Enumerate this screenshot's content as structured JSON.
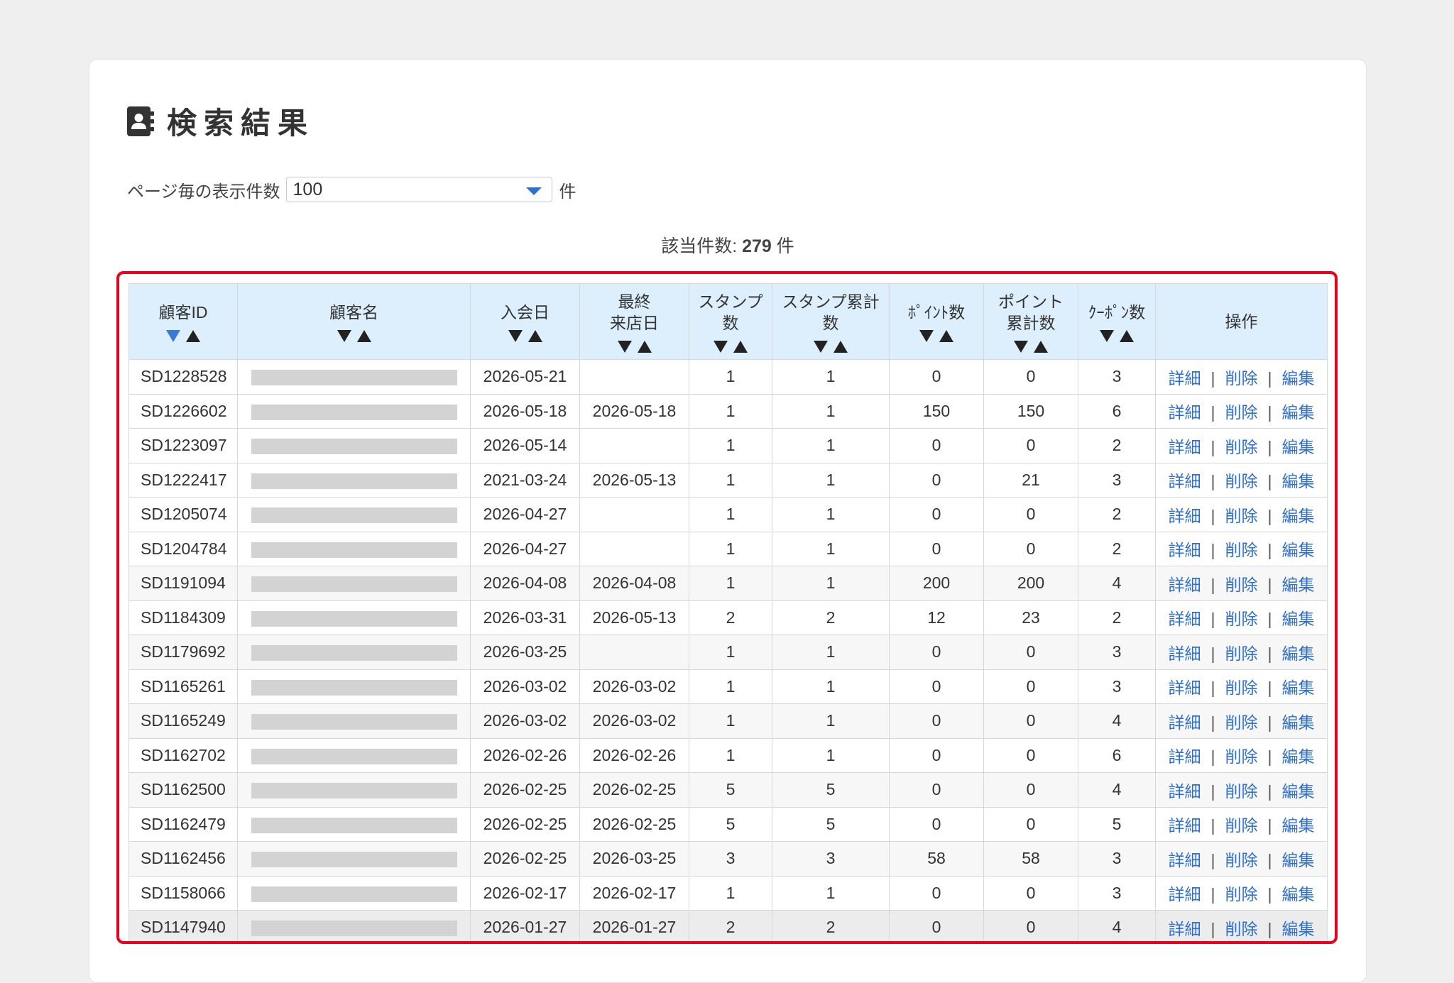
{
  "page": {
    "title": "検索結果",
    "icon": "contact-card-icon"
  },
  "per_page": {
    "label": "ページ毎の表示件数",
    "value": "100",
    "unit": "件"
  },
  "count": {
    "label": "該当件数:",
    "value": "279",
    "unit": "件"
  },
  "table": {
    "columns": [
      {
        "label": "顧客ID",
        "sort_active": "desc"
      },
      {
        "label": "顧客名"
      },
      {
        "label": "入会日"
      },
      {
        "label": "最終\n来店日"
      },
      {
        "label": "スタンプ\n数"
      },
      {
        "label": "スタンプ累計\n数"
      },
      {
        "label": "ﾎﾟｲﾝﾄ数"
      },
      {
        "label": "ポイント\n累計数"
      },
      {
        "label": "ｸｰﾎﾟﾝ数"
      },
      {
        "label": "操作"
      }
    ],
    "ops_labels": {
      "detail": "詳細",
      "delete": "削除",
      "edit": "編集",
      "separator": "|"
    },
    "rows": [
      {
        "id": "SD1228528",
        "join": "2026-05-21",
        "last": "",
        "stamp": "1",
        "stamp_total": "1",
        "points": "0",
        "points_total": "0",
        "coupons": "3"
      },
      {
        "id": "SD1226602",
        "join": "2026-05-18",
        "last": "2026-05-18",
        "stamp": "1",
        "stamp_total": "1",
        "points": "150",
        "points_total": "150",
        "coupons": "6"
      },
      {
        "id": "SD1223097",
        "join": "2026-05-14",
        "last": "",
        "stamp": "1",
        "stamp_total": "1",
        "points": "0",
        "points_total": "0",
        "coupons": "2"
      },
      {
        "id": "SD1222417",
        "join": "2021-03-24",
        "last": "2026-05-13",
        "stamp": "1",
        "stamp_total": "1",
        "points": "0",
        "points_total": "21",
        "coupons": "3"
      },
      {
        "id": "SD1205074",
        "join": "2026-04-27",
        "last": "",
        "stamp": "1",
        "stamp_total": "1",
        "points": "0",
        "points_total": "0",
        "coupons": "2"
      },
      {
        "id": "SD1204784",
        "join": "2026-04-27",
        "last": "",
        "stamp": "1",
        "stamp_total": "1",
        "points": "0",
        "points_total": "0",
        "coupons": "2"
      },
      {
        "id": "SD1191094",
        "join": "2026-04-08",
        "last": "2026-04-08",
        "stamp": "1",
        "stamp_total": "1",
        "points": "200",
        "points_total": "200",
        "coupons": "4"
      },
      {
        "id": "SD1184309",
        "join": "2026-03-31",
        "last": "2026-05-13",
        "stamp": "2",
        "stamp_total": "2",
        "points": "12",
        "points_total": "23",
        "coupons": "2"
      },
      {
        "id": "SD1179692",
        "join": "2026-03-25",
        "last": "",
        "stamp": "1",
        "stamp_total": "1",
        "points": "0",
        "points_total": "0",
        "coupons": "3"
      },
      {
        "id": "SD1165261",
        "join": "2026-03-02",
        "last": "2026-03-02",
        "stamp": "1",
        "stamp_total": "1",
        "points": "0",
        "points_total": "0",
        "coupons": "3"
      },
      {
        "id": "SD1165249",
        "join": "2026-03-02",
        "last": "2026-03-02",
        "stamp": "1",
        "stamp_total": "1",
        "points": "0",
        "points_total": "0",
        "coupons": "4"
      },
      {
        "id": "SD1162702",
        "join": "2026-02-26",
        "last": "2026-02-26",
        "stamp": "1",
        "stamp_total": "1",
        "points": "0",
        "points_total": "0",
        "coupons": "6"
      },
      {
        "id": "SD1162500",
        "join": "2026-02-25",
        "last": "2026-02-25",
        "stamp": "5",
        "stamp_total": "5",
        "points": "0",
        "points_total": "0",
        "coupons": "4"
      },
      {
        "id": "SD1162479",
        "join": "2026-02-25",
        "last": "2026-02-25",
        "stamp": "5",
        "stamp_total": "5",
        "points": "0",
        "points_total": "0",
        "coupons": "5"
      },
      {
        "id": "SD1162456",
        "join": "2026-02-25",
        "last": "2026-03-25",
        "stamp": "3",
        "stamp_total": "3",
        "points": "58",
        "points_total": "58",
        "coupons": "3"
      },
      {
        "id": "SD1158066",
        "join": "2026-02-17",
        "last": "2026-02-17",
        "stamp": "1",
        "stamp_total": "1",
        "points": "0",
        "points_total": "0",
        "coupons": "3"
      },
      {
        "id": "SD1147940",
        "join": "2026-01-27",
        "last": "2026-01-27",
        "stamp": "2",
        "stamp_total": "2",
        "points": "0",
        "points_total": "0",
        "coupons": "4"
      }
    ]
  },
  "colors": {
    "highlight_border": "#e8001c",
    "header_bg": "#ddeefc",
    "link": "#2f6fd0",
    "sort_active": "#3c78d8"
  }
}
